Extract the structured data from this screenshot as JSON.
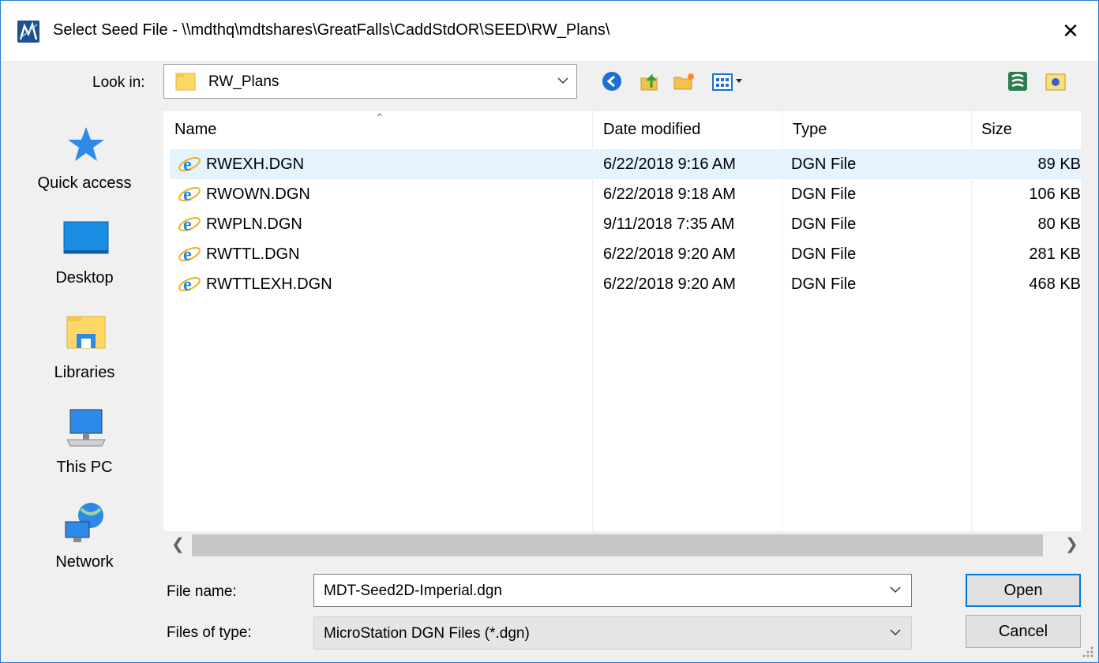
{
  "window": {
    "title": "Select Seed File - \\\\mdthq\\mdtshares\\GreatFalls\\CaddStdOR\\SEED\\RW_Plans\\",
    "close_glyph": "✕"
  },
  "look_in": {
    "label": "Look in:",
    "value": "RW_Plans"
  },
  "toolbar": {
    "icons": [
      "back-icon",
      "up-folder-icon",
      "new-folder-icon",
      "view-menu-icon",
      "network-globe-icon",
      "folder-properties-icon"
    ]
  },
  "places": [
    {
      "label": "Quick access",
      "icon": "star-icon"
    },
    {
      "label": "Desktop",
      "icon": "desktop-icon"
    },
    {
      "label": "Libraries",
      "icon": "libraries-icon"
    },
    {
      "label": "This PC",
      "icon": "computer-icon"
    },
    {
      "label": "Network",
      "icon": "network-icon"
    }
  ],
  "columns": {
    "name": "Name",
    "date": "Date modified",
    "type": "Type",
    "size": "Size"
  },
  "files": [
    {
      "name": "RWEXH.DGN",
      "date": "6/22/2018 9:16 AM",
      "type": "DGN File",
      "size": "89 KB"
    },
    {
      "name": "RWOWN.DGN",
      "date": "6/22/2018 9:18 AM",
      "type": "DGN File",
      "size": "106 KB"
    },
    {
      "name": "RWPLN.DGN",
      "date": "9/11/2018 7:35 AM",
      "type": "DGN File",
      "size": "80 KB"
    },
    {
      "name": "RWTTL.DGN",
      "date": "6/22/2018 9:20 AM",
      "type": "DGN File",
      "size": "281 KB"
    },
    {
      "name": "RWTTLEXH.DGN",
      "date": "6/22/2018 9:20 AM",
      "type": "DGN File",
      "size": "468 KB"
    }
  ],
  "filename": {
    "label": "File name:",
    "value": "MDT-Seed2D-Imperial.dgn"
  },
  "filetype": {
    "label": "Files of type:",
    "value": "MicroStation DGN Files (*.dgn)"
  },
  "buttons": {
    "open": "Open",
    "cancel": "Cancel"
  },
  "colors": {
    "accent": "#0078d7",
    "selection": "#e5f3ff"
  }
}
